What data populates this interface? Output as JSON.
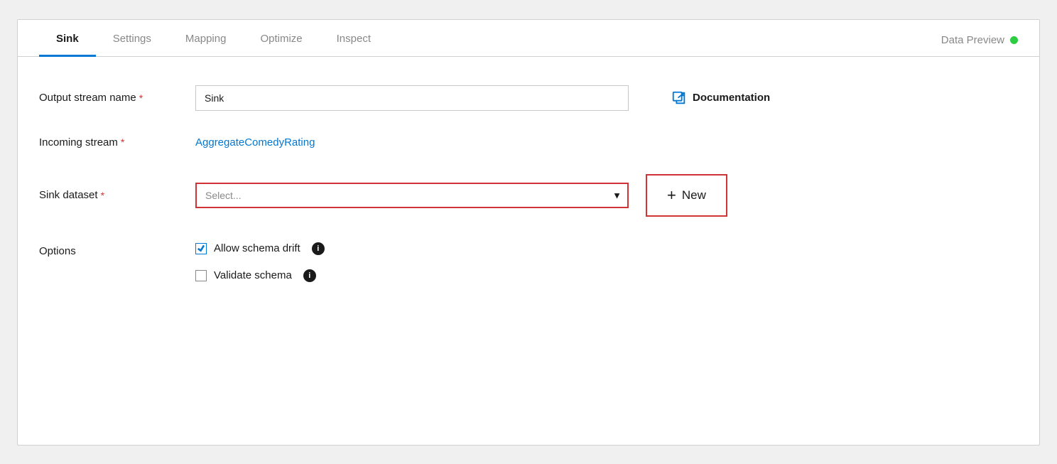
{
  "tabs": [
    {
      "id": "sink",
      "label": "Sink",
      "active": true
    },
    {
      "id": "settings",
      "label": "Settings",
      "active": false
    },
    {
      "id": "mapping",
      "label": "Mapping",
      "active": false
    },
    {
      "id": "optimize",
      "label": "Optimize",
      "active": false
    },
    {
      "id": "inspect",
      "label": "Inspect",
      "active": false
    },
    {
      "id": "data-preview",
      "label": "Data Preview",
      "active": false
    }
  ],
  "form": {
    "output_stream_name_label": "Output stream name",
    "output_stream_name_required": "*",
    "output_stream_name_value": "Sink",
    "incoming_stream_label": "Incoming stream",
    "incoming_stream_required": "*",
    "incoming_stream_value": "AggregateComedyRating",
    "sink_dataset_label": "Sink dataset",
    "sink_dataset_required": "*",
    "sink_dataset_placeholder": "Select...",
    "options_label": "Options",
    "allow_schema_drift_label": "Allow schema drift",
    "validate_schema_label": "Validate schema",
    "documentation_label": "Documentation",
    "new_button_label": "New",
    "new_button_plus": "+"
  }
}
